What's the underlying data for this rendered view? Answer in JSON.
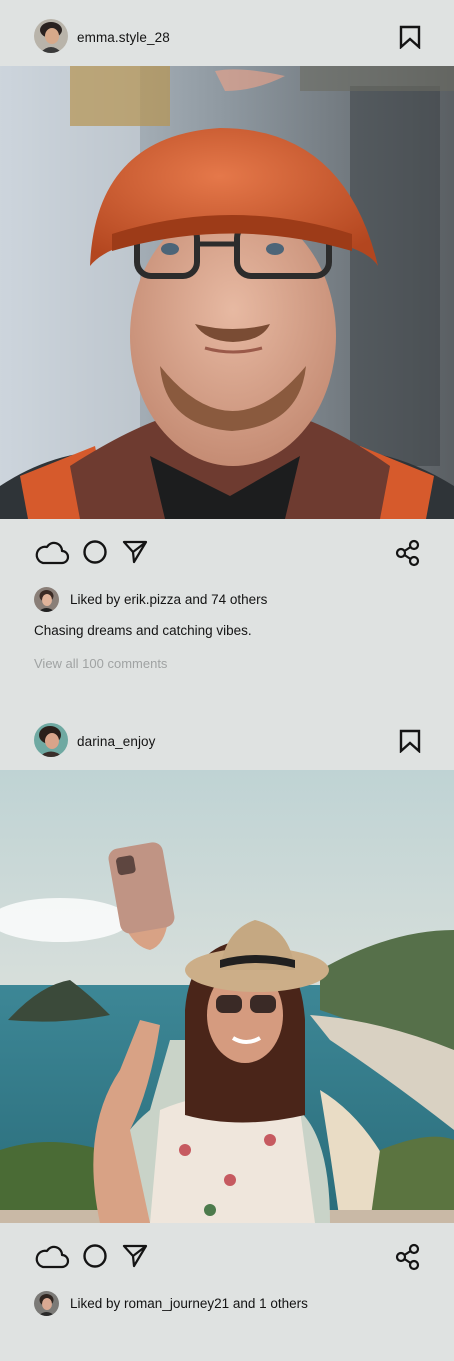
{
  "posts": [
    {
      "username": "emma.style_28",
      "liked_prefix": "Liked by ",
      "liked_user": "erik.pizza",
      "liked_suffix": " and 74 others",
      "caption": "Chasing dreams and catching vibes.",
      "view_comments": "View all 100 comments",
      "image_subject": "construction-worker-photo"
    },
    {
      "username": "darina_enjoy",
      "liked_prefix": "Liked by ",
      "liked_user": "roman_journey21",
      "liked_suffix": " and 1 others",
      "image_subject": "woman-selfie-beach-photo"
    }
  ],
  "icons": {
    "like": "cloud-icon",
    "comment": "circle-icon",
    "send": "send-arrow-icon",
    "share": "share-icon",
    "save": "bookmark-icon"
  },
  "colors": {
    "background": "#dfe2e1",
    "text": "#141414",
    "muted": "#a0a3a3"
  }
}
